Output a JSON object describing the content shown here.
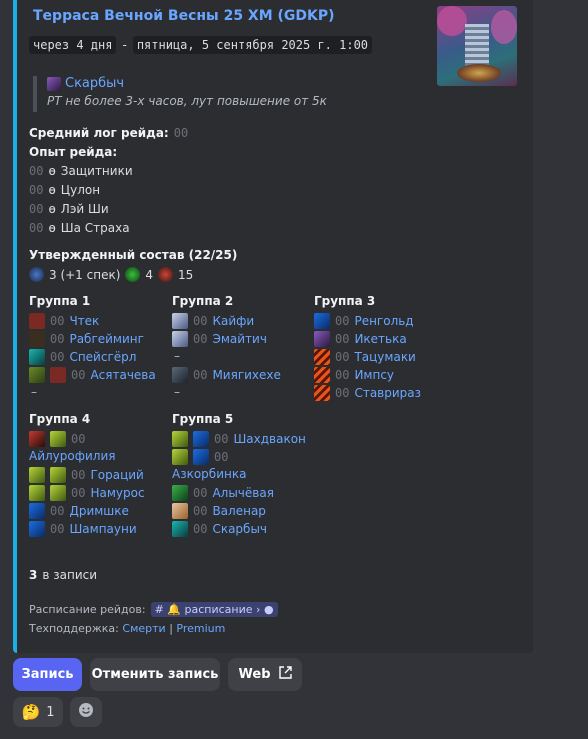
{
  "embed": {
    "title": "Терраса Вечной Весны 25 ХМ (GDKP)",
    "relative_time": "через 4 дня",
    "separator": "-",
    "datetime": "пятница, 5 сентября 2025 г. 1:00",
    "leader": "Скарбыч",
    "note": "РТ не более 3-х часов, лут повышение от 5к",
    "avg_log_label": "Средний лог рейда:",
    "avg_log_value": "00",
    "experience_label": "Опыт рейда:",
    "experience": [
      {
        "value": "00",
        "bullet": "ɵ",
        "boss": "Защитники"
      },
      {
        "value": "00",
        "bullet": "ɵ",
        "boss": "Цулон"
      },
      {
        "value": "00",
        "bullet": "ɵ",
        "boss": "Лэй Ши"
      },
      {
        "value": "00",
        "bullet": "ɵ",
        "boss": "Ша Страха"
      }
    ],
    "roster_label": "Утвержденный состав (22/25)",
    "roles": {
      "tanks": "3 (+1 спек)",
      "healers": "4",
      "dps": "15"
    },
    "groups": [
      {
        "title": "Группа 1",
        "members": [
          {
            "score": "00",
            "name": "Чтек"
          },
          {
            "score": "00",
            "name": "Рабгейминг"
          },
          {
            "score": "00",
            "name": "Спейсгёрл"
          },
          {
            "score": "00",
            "name": "Асятачева"
          }
        ],
        "empty": "–"
      },
      {
        "title": "Группа 2",
        "members": [
          {
            "score": "00",
            "name": "Кайфи"
          },
          {
            "score": "00",
            "name": "Эмайтич"
          }
        ],
        "empty": "–",
        "members2": [
          {
            "score": "00",
            "name": "Миягихехе"
          }
        ],
        "empty2": "–"
      },
      {
        "title": "Группа 3",
        "members": [
          {
            "score": "00",
            "name": "Ренгольд"
          },
          {
            "score": "00",
            "name": "Икетька"
          },
          {
            "score": "00",
            "name": "Тацумаки"
          },
          {
            "score": "00",
            "name": "Импсу"
          },
          {
            "score": "00",
            "name": "Ставрираз"
          }
        ]
      },
      {
        "title": "Группа 4",
        "members": [
          {
            "score": "00",
            "name": "Айлурофилия"
          },
          {
            "score": "00",
            "name": "Гораций"
          },
          {
            "score": "00",
            "name": "Намурос"
          },
          {
            "score": "00",
            "name": "Дримшке"
          },
          {
            "score": "00",
            "name": "Шампауни"
          }
        ]
      },
      {
        "title": "Группа 5",
        "members": [
          {
            "score": "00",
            "name": "Шахдвакон"
          },
          {
            "score": "00",
            "name": "Азкорбинка"
          },
          {
            "score": "00",
            "name": "Алычёвая"
          },
          {
            "score": "00",
            "name": "Валенар"
          },
          {
            "score": "00",
            "name": "Скарбыч"
          }
        ]
      }
    ],
    "signed_count": "3",
    "signed_label": "в записи",
    "schedule_label": "Расписание рейдов:",
    "schedule_channel": "расписание",
    "support_label": "Техподдержка:",
    "support_link1": "Смерти",
    "support_sep": "|",
    "support_link2": "Premium"
  },
  "buttons": {
    "signup": "Запись",
    "cancel": "Отменить запись",
    "web": "Web"
  },
  "reactions": {
    "count": "1"
  },
  "colors": {
    "accent": "#1ab0e6",
    "link": "#6aa6ff",
    "primary": "#5865f2"
  }
}
